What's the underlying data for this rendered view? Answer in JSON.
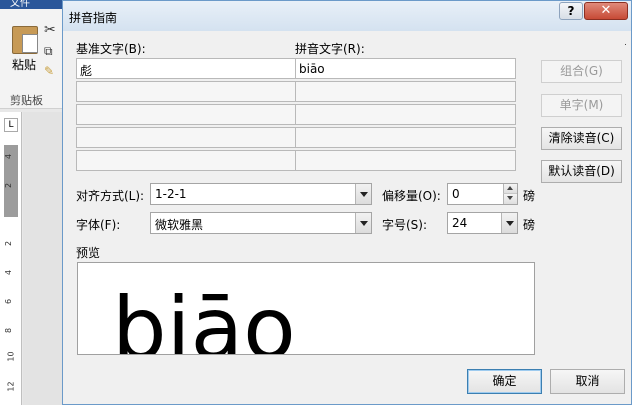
{
  "background": {
    "file_tab": "文件",
    "paste_label": "粘贴",
    "clipboard_label": "剪贴板",
    "ruler_corner": "L",
    "ruler_numbers": [
      "4",
      "2",
      "2",
      "4",
      "6",
      "8",
      "10",
      "12"
    ]
  },
  "dialog": {
    "title": "拼音指南",
    "help": "?",
    "close": "✕"
  },
  "labels": {
    "base_text": "基准文字(B):",
    "ruby_text": "拼音文字(R):",
    "alignment": "对齐方式(L):",
    "offset": "偏移量(O):",
    "font": "字体(F):",
    "size": "字号(S):",
    "preview": "预览",
    "pound1": "磅",
    "pound2": "磅"
  },
  "grid": {
    "rows": [
      {
        "base": "彪",
        "ruby": "biāo"
      },
      {
        "base": "",
        "ruby": ""
      },
      {
        "base": "",
        "ruby": ""
      },
      {
        "base": "",
        "ruby": ""
      },
      {
        "base": "",
        "ruby": ""
      }
    ]
  },
  "buttons": {
    "group": "组合(G)",
    "char": "单字(M)",
    "clear": "清除读音(C)",
    "default": "默认读音(D)",
    "ok": "确定",
    "cancel": "取消"
  },
  "fields": {
    "alignment_value": "1-2-1",
    "offset_value": "0",
    "font_value": "微软雅黑",
    "size_value": "24"
  },
  "preview": {
    "text": "biāo"
  }
}
